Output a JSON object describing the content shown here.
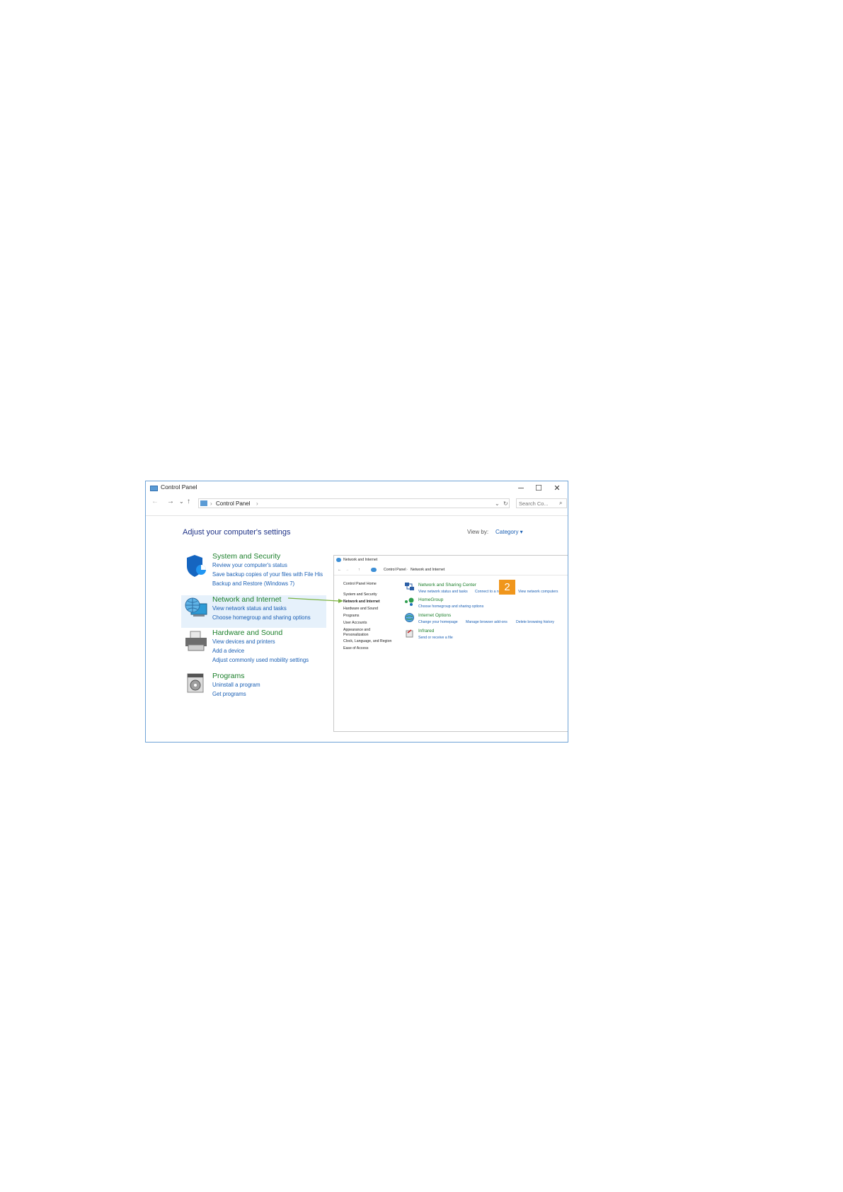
{
  "window": {
    "title": "Control Panel",
    "controls": {
      "minimize": "─",
      "maximize": "☐",
      "close": "✕"
    },
    "address": {
      "breadcrumb": [
        "Control Panel"
      ],
      "separator": "›"
    },
    "search_placeholder": "Search Co...",
    "heading": "Adjust your computer's settings",
    "view_by": {
      "label": "View by:",
      "value": "Category ▾"
    },
    "categories": [
      {
        "title": "System and Security",
        "icon": "shield-icon",
        "links": [
          "Review your computer's status",
          "Save backup copies of your files with File His",
          "Backup and Restore (Windows 7)"
        ]
      },
      {
        "title": "Network and Internet",
        "icon": "globe-network-icon",
        "links": [
          "View network status and tasks",
          "Choose homegroup and sharing options"
        ]
      },
      {
        "title": "Hardware and Sound",
        "icon": "printer-icon",
        "links": [
          "View devices and printers",
          "Add a device",
          "Adjust commonly used mobility settings"
        ]
      },
      {
        "title": "Programs",
        "icon": "programs-icon",
        "links": [
          "Uninstall a program",
          "Get programs"
        ]
      }
    ]
  },
  "overlay": {
    "title": "Network and Internet",
    "breadcrumb": [
      "Control Panel",
      "Network and Internet"
    ],
    "sidebar": [
      "Control Panel Home",
      "System and Security",
      "Network and Internet",
      "Hardware and Sound",
      "Programs",
      "User Accounts",
      "Appearance and Personalization",
      "Clock, Language, and Region",
      "Ease of Access"
    ],
    "items": [
      {
        "title": "Network and Sharing Center",
        "links": [
          "View network status and tasks",
          "Connect to a network",
          "View network computers"
        ]
      },
      {
        "title": "HomeGroup",
        "links": [
          "Choose homegroup and sharing options"
        ]
      },
      {
        "title": "Internet Options",
        "links": [
          "Change your homepage",
          "Manage browser add-ons",
          "Delete browsing history"
        ]
      },
      {
        "title": "Infrared",
        "links": [
          "Send or receive a file"
        ]
      }
    ],
    "badge": "2"
  },
  "colors": {
    "accent_green": "#1b7f2a",
    "link_blue": "#1a5fb4",
    "badge_orange": "#f0961c",
    "highlight": "#e6f1fb"
  }
}
